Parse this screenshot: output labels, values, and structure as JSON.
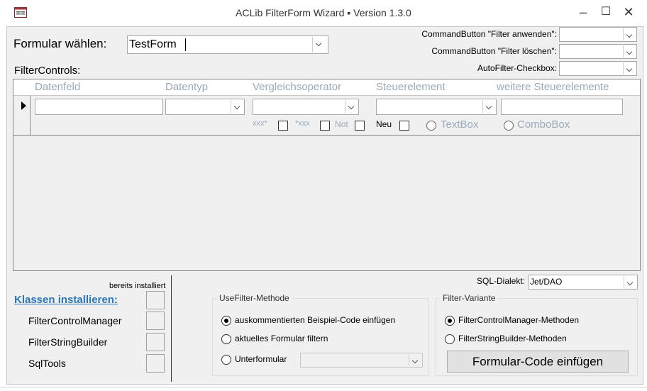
{
  "window": {
    "title": "ACLib FilterForm Wizard  ▪  Version 1.3.0",
    "minimize_glyph": "–",
    "maximize_glyph": "☐",
    "close_glyph": "✕"
  },
  "form_select": {
    "label": "Formular wählen:",
    "value": "TestForm"
  },
  "commandbuttons": {
    "apply_label": "CommandButton \"Filter anwenden\":",
    "clear_label": "CommandButton \"Filter löschen\":",
    "autofilter_label": "AutoFilter-Checkbox:"
  },
  "filtercontrols": {
    "label": "FilterControls:",
    "headers": [
      "Datenfeld",
      "Datentyp",
      "Vergleichsoperator",
      "Steuerelement",
      "weitere Steuerelemente"
    ],
    "row": {
      "like_left": "xxx*",
      "like_right": "*xxx",
      "not": "Not",
      "neu": "Neu",
      "opt_textbox": "TextBox",
      "opt_combobox": "ComboBox"
    }
  },
  "classes": {
    "installed_header": "bereits installiert",
    "install_link": "Klassen installieren:",
    "items": [
      "FilterControlManager",
      "FilterStringBuilder",
      "SqlTools"
    ]
  },
  "sql": {
    "label": "SQL-Dialekt:",
    "value": "Jet/DAO"
  },
  "usefilter": {
    "legend": "UseFilter-Methode",
    "options": [
      "auskommentierten Beispiel-Code einfügen",
      "aktuelles Formular filtern",
      "Unterformular"
    ],
    "selected_index": 0
  },
  "variante": {
    "legend": "Filter-Variante",
    "options": [
      "FilterControlManager-Methoden",
      "FilterStringBuilder-Methoden"
    ],
    "selected_index": 0,
    "insert_button": "Formular-Code einfügen"
  }
}
